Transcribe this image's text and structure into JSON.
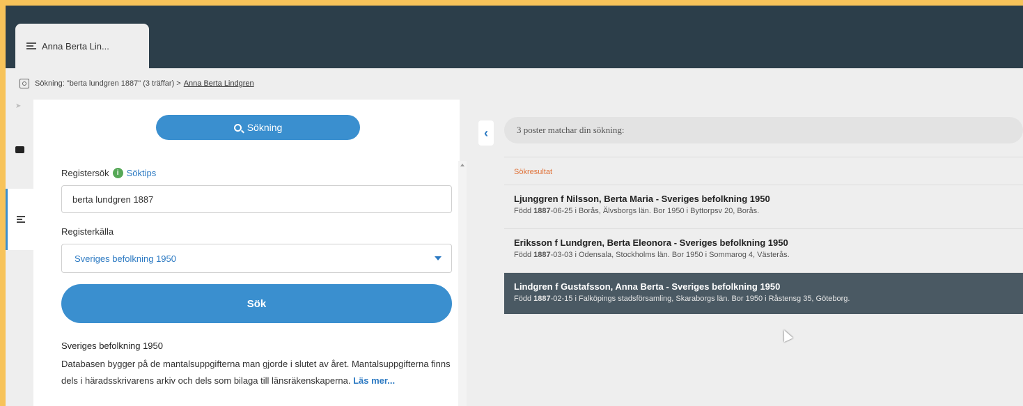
{
  "tab": {
    "label": "Anna Berta Lin..."
  },
  "breadcrumb": {
    "search_text": "Sökning: \"berta lundgren 1887\" (3 träffar) >",
    "link": "Anna Berta Lindgren"
  },
  "left_panel": {
    "search_mode_label": "Sökning",
    "register_label": "Registersök",
    "tips_link": "Söktips",
    "search_value": "berta lundgren 1887",
    "source_label": "Registerkälla",
    "source_selected": "Sveriges befolkning 1950",
    "search_button": "Sök",
    "db_title": "Sveriges befolkning 1950",
    "db_description": "Databasen bygger på de mantalsuppgifterna man gjorde i slutet av året. Mantalsuppgifterna finns dels i häradsskrivarens arkiv och dels som bilaga till länsräkenskaperna.",
    "read_more": "Läs mer..."
  },
  "results": {
    "summary": "3 poster matchar din sökning:",
    "heading": "Sökresultat",
    "items": [
      {
        "title": "Ljunggren f Nilsson, Berta Maria - Sveriges befolkning 1950",
        "born_prefix": "Född ",
        "year": "1887",
        "detail_rest": "-06-25 i Borås, Älvsborgs län. Bor 1950 i Byttorpsv 20, Borås."
      },
      {
        "title": "Eriksson f Lundgren, Berta Eleonora - Sveriges befolkning 1950",
        "born_prefix": "Född ",
        "year": "1887",
        "detail_rest": "-03-03 i Odensala, Stockholms län. Bor 1950 i Sommarog 4, Västerås."
      },
      {
        "title": "Lindgren f Gustafsson, Anna Berta - Sveriges befolkning 1950",
        "born_prefix": "Född ",
        "year": "1887",
        "detail_rest": "-02-15 i Falköpings stadsförsamling, Skaraborgs län. Bor 1950 i Råstensg 35, Göteborg."
      }
    ]
  },
  "colors": {
    "accent": "#3a8fcf",
    "header_bg": "#2c3e4a",
    "selected_bg": "#4a5963",
    "results_heading": "#e0733a"
  }
}
